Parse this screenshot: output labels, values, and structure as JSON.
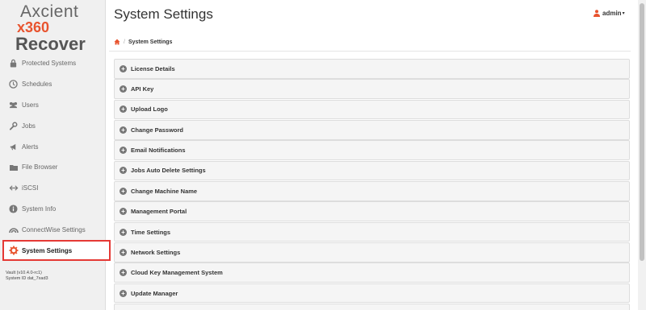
{
  "app": {
    "logo_line1": "Axcient",
    "logo_line2": "x360",
    "logo_line3": "Recover",
    "version": "Vault (v10.4.0-rc1)",
    "system_id": "System ID dat_7xad3"
  },
  "colors": {
    "accent": "#e8542f",
    "active_border": "#e53935",
    "icon": "#777777"
  },
  "sidebar": {
    "items": [
      {
        "label": "Protected Systems",
        "icon": "lock-icon"
      },
      {
        "label": "Schedules",
        "icon": "clock-icon"
      },
      {
        "label": "Users",
        "icon": "users-icon"
      },
      {
        "label": "Jobs",
        "icon": "wrench-icon"
      },
      {
        "label": "Alerts",
        "icon": "bullhorn-icon"
      },
      {
        "label": "File Browser",
        "icon": "folder-icon"
      },
      {
        "label": "iSCSI",
        "icon": "iscsi-icon"
      },
      {
        "label": "System Info",
        "icon": "info-icon"
      },
      {
        "label": "ConnectWise Settings",
        "icon": "connectwise-icon"
      },
      {
        "label": "System Settings",
        "icon": "gear-icon",
        "active": true
      }
    ]
  },
  "header": {
    "title": "System Settings",
    "user": "admin"
  },
  "breadcrumb": {
    "home_icon": "home-icon",
    "separator": "/",
    "current": "System Settings"
  },
  "panels": [
    "License Details",
    "API Key",
    "Upload Logo",
    "Change Password",
    "Email Notifications",
    "Jobs Auto Delete Settings",
    "Change Machine Name",
    "Management Portal",
    "Time Settings",
    "Network Settings",
    "Cloud Key Management System",
    "Update Manager",
    ""
  ]
}
